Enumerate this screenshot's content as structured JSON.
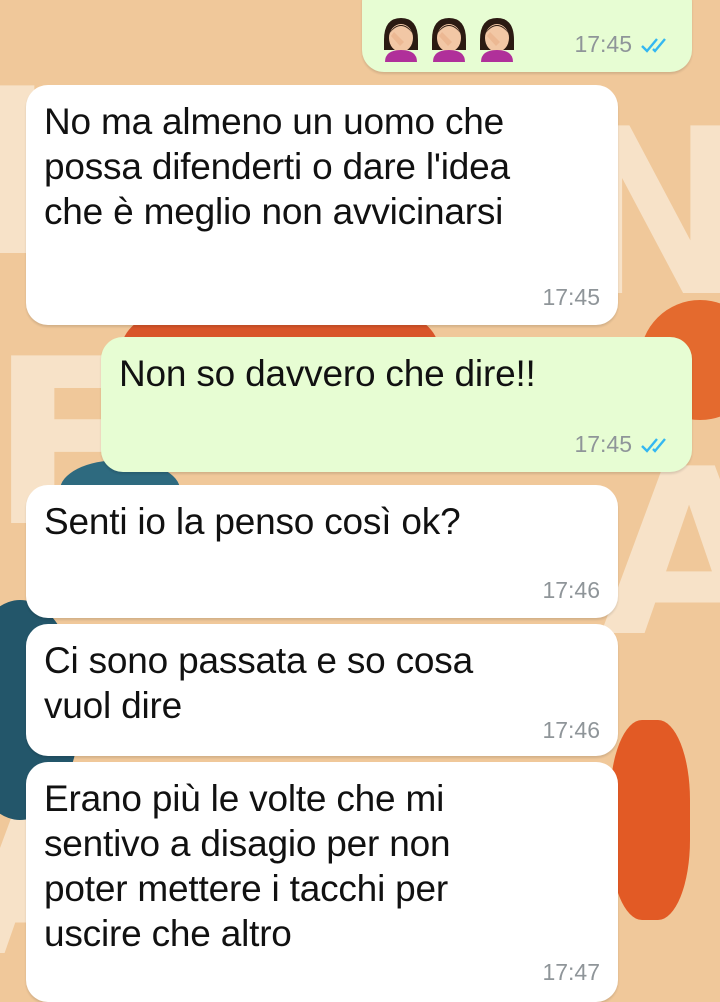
{
  "messages": [
    {
      "direction": "outgoing",
      "emojis": [
        "woman-facepalming-emoji",
        "woman-facepalming-emoji",
        "woman-facepalming-emoji"
      ],
      "time": "17:45",
      "read": true
    },
    {
      "direction": "incoming",
      "text": "No ma almeno un uomo che\npossa difenderti o dare l'idea\nche è meglio non avvicinarsi",
      "time": "17:45"
    },
    {
      "direction": "outgoing",
      "text": "Non so davvero che dire!!",
      "time": "17:45",
      "read": true
    },
    {
      "direction": "incoming",
      "text": "Senti io la penso così ok?",
      "time": "17:46"
    },
    {
      "direction": "incoming",
      "text": "Ci sono passata e so cosa\nvuol dire",
      "time": "17:46"
    },
    {
      "direction": "incoming",
      "text": "Erano più le volte che mi\nsentivo a disagio per non\npoter mettere i tacchi per\nuscire che altro",
      "time": "17:47"
    }
  ],
  "colors": {
    "incoming": "#ffffff",
    "outgoing": "#e7fdd3",
    "tick": "#34b7f1",
    "meta": "#8f9599"
  }
}
